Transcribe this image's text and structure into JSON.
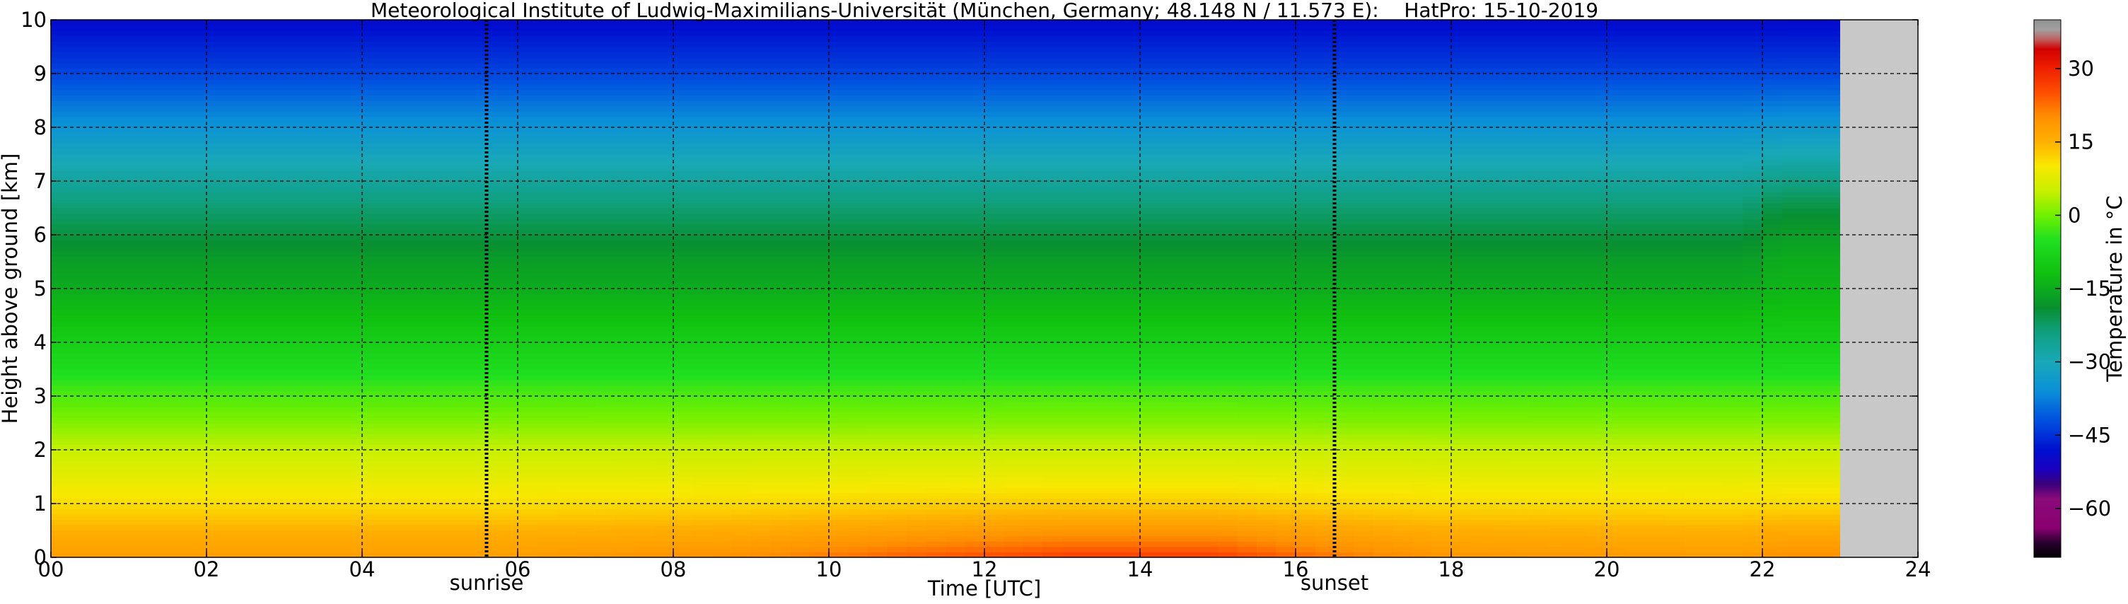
{
  "chart_data": {
    "type": "heatmap",
    "title": "Meteorological Institute of Ludwig-Maximilians-Universität (München, Germany; 48.148 N / 11.573 E):    HatPro: 15-10-2019",
    "xlabel": "Time [UTC]",
    "ylabel": "Height above ground [km]",
    "xlim": [
      0,
      24
    ],
    "ylim": [
      0,
      10
    ],
    "x_ticks": [
      0,
      2,
      4,
      6,
      8,
      10,
      12,
      14,
      16,
      18,
      20,
      22,
      24
    ],
    "x_tick_labels": [
      "00",
      "02",
      "04",
      "06",
      "08",
      "10",
      "12",
      "14",
      "16",
      "18",
      "20",
      "22",
      "24"
    ],
    "y_ticks": [
      0,
      1,
      2,
      3,
      4,
      5,
      6,
      7,
      8,
      9,
      10
    ],
    "y_tick_labels": [
      "0",
      "1",
      "2",
      "3",
      "4",
      "5",
      "6",
      "7",
      "8",
      "9",
      "10"
    ],
    "grid": true,
    "data_end_hour": 23.0,
    "missing_color": "#c8c8c8",
    "events": [
      {
        "label": "sunrise",
        "hour": 5.6
      },
      {
        "label": "sunset",
        "hour": 16.5
      }
    ],
    "colorbar": {
      "label": "Temperature in °C",
      "vmin": -70,
      "vmax": 40,
      "ticks": [
        30,
        15,
        0,
        -15,
        -30,
        -45,
        -60
      ],
      "tick_labels": [
        "30",
        "15",
        "0",
        "−15",
        "−30",
        "−45",
        "−60"
      ],
      "colors": [
        [
          -70,
          "#000000"
        ],
        [
          -67,
          "#2a0030"
        ],
        [
          -64,
          "#8a0070"
        ],
        [
          -58,
          "#8a0a7a"
        ],
        [
          -55,
          "#3a007a"
        ],
        [
          -52,
          "#1a00c0"
        ],
        [
          -48,
          "#0010d0"
        ],
        [
          -42,
          "#0050e0"
        ],
        [
          -36,
          "#0a90d8"
        ],
        [
          -30,
          "#18a8b8"
        ],
        [
          -24,
          "#10a080"
        ],
        [
          -19,
          "#089030"
        ],
        [
          -12,
          "#10c010"
        ],
        [
          -5,
          "#20e020"
        ],
        [
          0,
          "#70f000"
        ],
        [
          5,
          "#c8f000"
        ],
        [
          10,
          "#f8e800"
        ],
        [
          15,
          "#ffb000"
        ],
        [
          20,
          "#ff9000"
        ],
        [
          25,
          "#ff5000"
        ],
        [
          30,
          "#f02000"
        ],
        [
          34,
          "#d00000"
        ],
        [
          36,
          "#c06060"
        ],
        [
          38,
          "#a0a0a0"
        ],
        [
          40,
          "#909090"
        ]
      ]
    },
    "profile": {
      "heights_km": [
        0,
        0.5,
        1,
        1.5,
        2,
        2.5,
        3,
        3.5,
        4,
        4.5,
        5,
        5.5,
        6,
        6.5,
        7,
        7.5,
        8,
        8.5,
        9,
        9.5,
        10
      ],
      "base_temp_c": [
        18,
        15,
        11,
        8,
        5,
        1,
        -2,
        -6,
        -9,
        -12,
        -15,
        -17,
        -20,
        -23,
        -27,
        -31,
        -35,
        -39,
        -43,
        -46,
        -49
      ],
      "surface_anomaly_by_hour": [
        [
          0,
          0
        ],
        [
          6,
          0
        ],
        [
          9,
          2
        ],
        [
          11,
          6
        ],
        [
          13,
          9
        ],
        [
          15,
          9
        ],
        [
          16.5,
          4
        ],
        [
          18,
          1
        ],
        [
          21.8,
          0
        ],
        [
          22.2,
          2
        ],
        [
          23,
          2
        ]
      ],
      "upper_anomaly_by_hour": [
        [
          0,
          0
        ],
        [
          21.8,
          0
        ],
        [
          22.2,
          3
        ],
        [
          23,
          3
        ]
      ]
    }
  }
}
